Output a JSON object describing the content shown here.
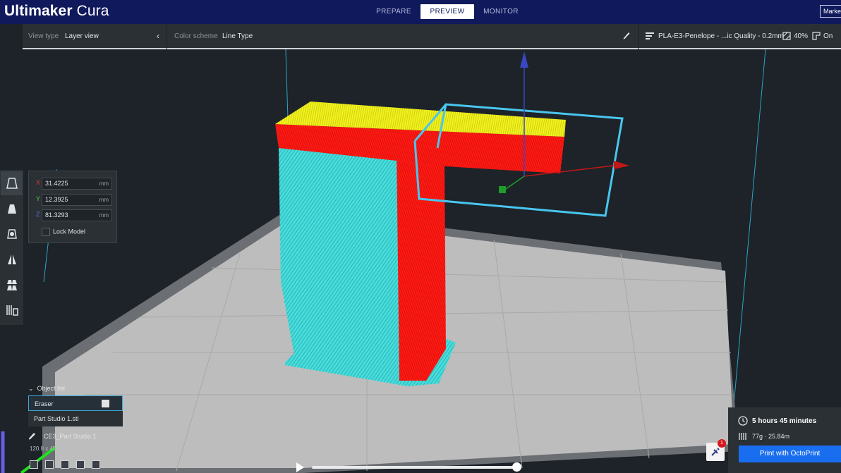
{
  "app": {
    "name_bold": "Ultimaker",
    "name_light": "Cura"
  },
  "stages": [
    {
      "label": "PREPARE",
      "active": false
    },
    {
      "label": "PREVIEW",
      "active": true
    },
    {
      "label": "MONITOR",
      "active": false
    }
  ],
  "marketplace_label": "Marke",
  "view_panel": {
    "label": "View type",
    "value": "Layer view"
  },
  "color_panel": {
    "label": "Color scheme",
    "value": "Line Type"
  },
  "print_settings": {
    "profile": "PLA-E3-Penelope - ...ic Quality - 0.2mm",
    "infill": "40%",
    "support": "On"
  },
  "move": {
    "x": {
      "label": "X",
      "value": "31.4225",
      "unit": "mm",
      "color": "#e0343a"
    },
    "y": {
      "label": "Y",
      "value": "12.3925",
      "unit": "mm",
      "color": "#4fc84a"
    },
    "z": {
      "label": "Z",
      "value": "81.3293",
      "unit": "mm",
      "color": "#5a78d8"
    },
    "lock_label": "Lock Model"
  },
  "tools": [
    "move-icon",
    "scale-icon",
    "rotate-icon",
    "mirror-icon",
    "per-model-settings-icon",
    "support-blocker-icon"
  ],
  "object_list": {
    "title": "Object list",
    "items": [
      {
        "name": "Eraser",
        "selected": true
      },
      {
        "name": "Part Studio 1.stl",
        "selected": false
      }
    ]
  },
  "job": {
    "name": "CE3_Part Studio 1",
    "dimensions": "120.8 x 45.6 x 101.7 mm"
  },
  "print": {
    "time": "5 hours 45 minutes",
    "material": "77g · 25.84m",
    "button": "Print with OctoPrint",
    "plugin_badge": "1"
  },
  "colors": {
    "header": "#10195b",
    "shell_red": "#ff1a14",
    "skin_yellow": "#f2f21e",
    "support_cyan": "#49e0e0",
    "bed": "#bdbdbd",
    "accent_blue": "#196ef0"
  }
}
